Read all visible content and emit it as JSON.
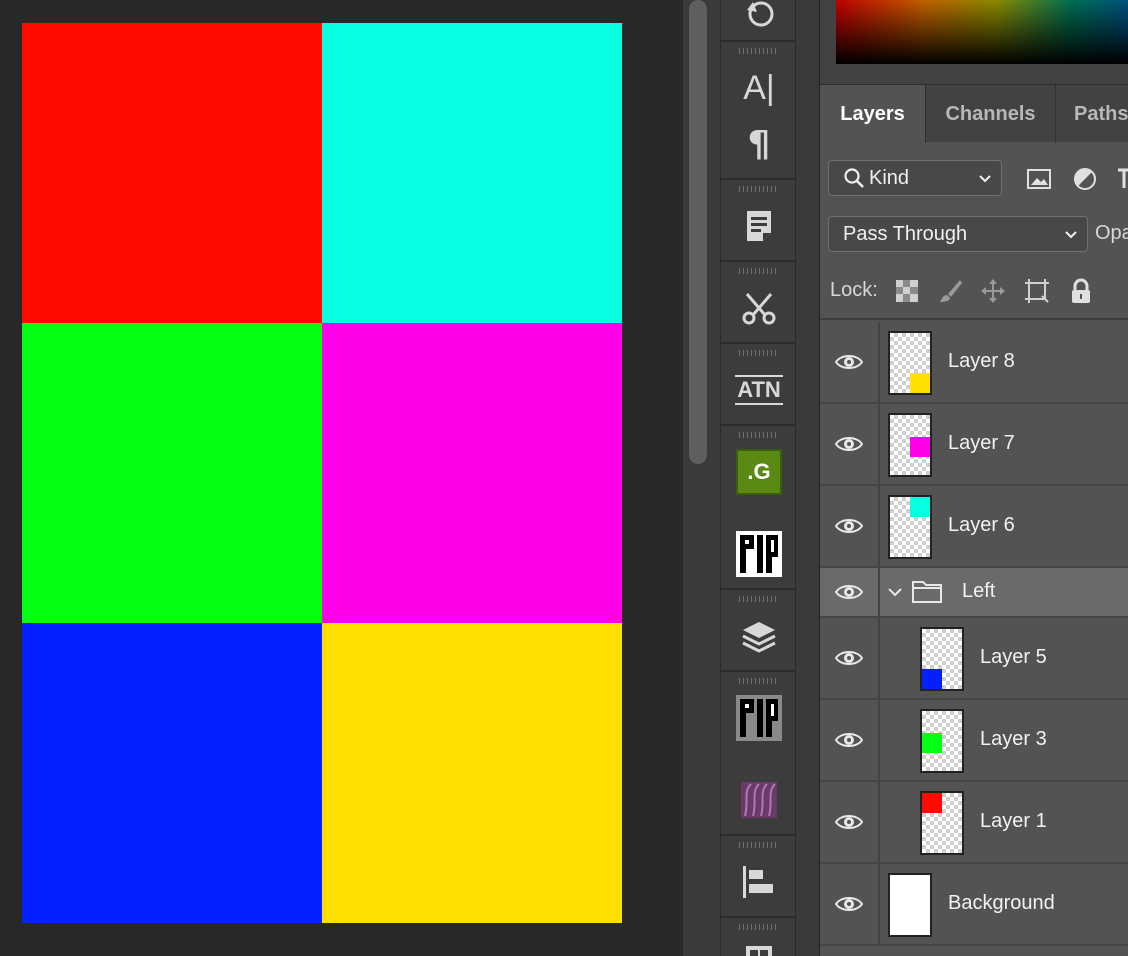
{
  "canvas": {
    "swatches": [
      {
        "name": "red",
        "color": "#ff0a00"
      },
      {
        "name": "cyan",
        "color": "#05ffe0"
      },
      {
        "name": "green",
        "color": "#05ff12"
      },
      {
        "name": "magenta",
        "color": "#ff00e8"
      },
      {
        "name": "blue",
        "color": "#0520ff"
      },
      {
        "name": "yellow",
        "color": "#ffe000"
      }
    ]
  },
  "tools": {
    "type_glyph": "A|",
    "paragraph_glyph": "¶",
    "actions_glyph": "ATN",
    "g_plugin_glyph": ".G"
  },
  "panel": {
    "tabs": [
      {
        "label": "Layers",
        "active": true
      },
      {
        "label": "Channels",
        "active": false
      },
      {
        "label": "Paths",
        "active": false
      }
    ],
    "filter": {
      "kind_label": "Kind"
    },
    "blend_mode": "Pass Through",
    "opacity_label": "Opa",
    "lock_label": "Lock:",
    "layers": [
      {
        "name": "Layer 8",
        "visible": true,
        "mini_color": "#ffe000",
        "mini_pos": "bottom-right"
      },
      {
        "name": "Layer 7",
        "visible": true,
        "mini_color": "#ff00e8",
        "mini_pos": "middle-right"
      },
      {
        "name": "Layer 6",
        "visible": true,
        "mini_color": "#05ffe0",
        "mini_pos": "top-right"
      },
      {
        "name": "Left",
        "type": "group",
        "expanded": true,
        "visible": true
      },
      {
        "name": "Layer 5",
        "visible": true,
        "mini_color": "#0520ff",
        "mini_pos": "bottom-left",
        "indent": true
      },
      {
        "name": "Layer 3",
        "visible": true,
        "mini_color": "#05ff12",
        "mini_pos": "middle-left",
        "indent": true
      },
      {
        "name": "Layer 1",
        "visible": true,
        "mini_color": "#ff0a00",
        "mini_pos": "top-left",
        "indent": true
      },
      {
        "name": "Background",
        "visible": true,
        "solid": true
      }
    ]
  }
}
